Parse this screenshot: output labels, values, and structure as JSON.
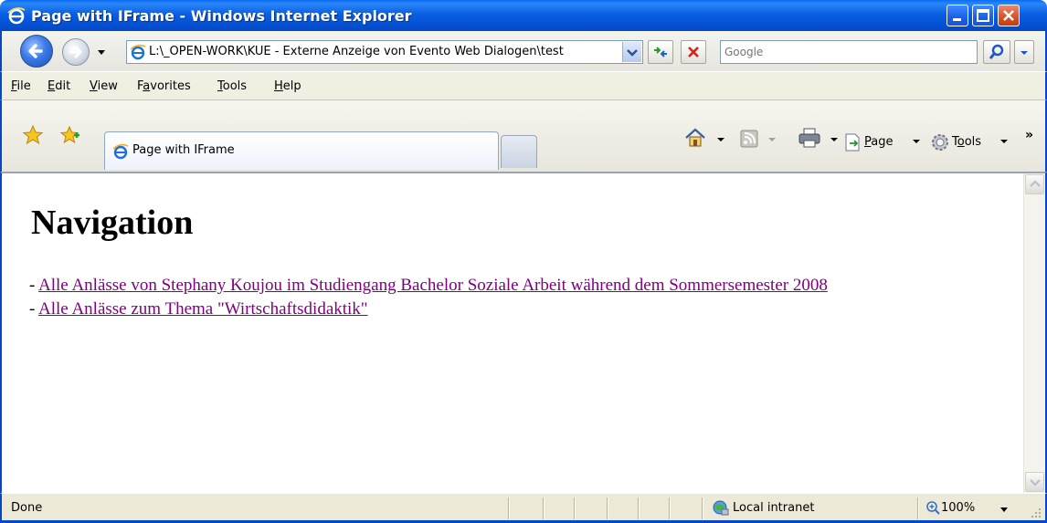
{
  "window": {
    "title": "Page with IFrame - Windows Internet Explorer"
  },
  "addressbar": {
    "url": "L:\\_OPEN-WORK\\KUE - Externe Anzeige von Evento Web Dialogen\\test",
    "search_placeholder": "Google"
  },
  "menubar": {
    "items": [
      {
        "label_prefix": "",
        "label_u": "F",
        "label_rest": "ile"
      },
      {
        "label_prefix": "",
        "label_u": "E",
        "label_rest": "dit"
      },
      {
        "label_prefix": "",
        "label_u": "V",
        "label_rest": "iew"
      },
      {
        "label_prefix": "F",
        "label_u": "a",
        "label_rest": "vorites"
      },
      {
        "label_prefix": "",
        "label_u": "T",
        "label_rest": "ools"
      },
      {
        "label_prefix": "",
        "label_u": "H",
        "label_rest": "elp"
      }
    ]
  },
  "tabs": {
    "active_label": "Page with IFrame"
  },
  "commandbar": {
    "page_prefix": "",
    "page_u": "P",
    "page_rest": "age",
    "tools_prefix": "T",
    "tools_u": "o",
    "tools_rest": "ols"
  },
  "content": {
    "heading": "Navigation",
    "links": [
      {
        "prefix": "- ",
        "text": "Alle Anlässe von Stephany Koujou im Studiengang Bachelor Soziale Arbeit während dem Sommersemester 2008"
      },
      {
        "prefix": "- ",
        "text": "Alle Anlässe zum Thema \"Wirtschaftsdidaktik\""
      }
    ]
  },
  "statusbar": {
    "status": "Done",
    "zone": "Local intranet",
    "zoom": "100%"
  },
  "colors": {
    "titlebar": "#0552d6",
    "visited_link": "#800080",
    "close_button": "#d9532c"
  }
}
